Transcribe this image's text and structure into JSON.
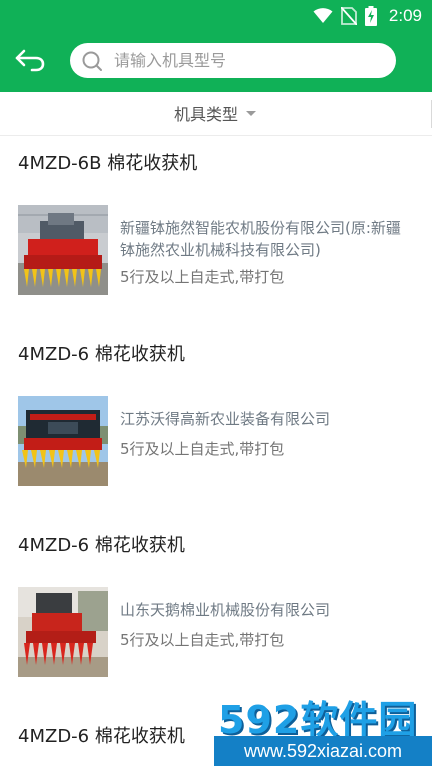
{
  "status_bar": {
    "time": "2:09"
  },
  "search": {
    "placeholder": "请输入机具型号",
    "value": ""
  },
  "filter": {
    "label": "机具类型"
  },
  "items": [
    {
      "title": "4MZD-6B 棉花收获机",
      "company": "新疆钵施然智能农机股份有限公司(原:新疆\n钵施然农业机械科技有限公司)",
      "spec": "5行及以上自走式,带打包"
    },
    {
      "title": "4MZD-6 棉花收获机",
      "company": "江苏沃得高新农业装备有限公司",
      "spec": "5行及以上自走式,带打包"
    },
    {
      "title": "4MZD-6 棉花收获机",
      "company": "山东天鹅棉业机械股份有限公司",
      "spec": "5行及以上自走式,带打包"
    },
    {
      "title": "4MZD-6 棉花收获机"
    }
  ],
  "watermark": {
    "brand": "592软件园",
    "url": "www.592xiazai.com"
  }
}
